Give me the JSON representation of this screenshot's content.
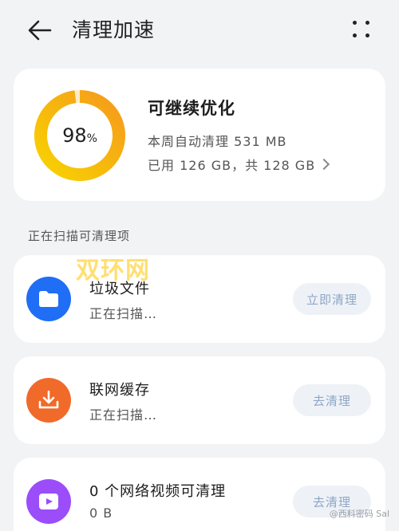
{
  "header": {
    "title": "清理加速",
    "back_icon": "arrow-left-icon",
    "more_icon": "more-dots-icon"
  },
  "storage": {
    "percent_value": "98",
    "percent_unit": "%",
    "percent_fraction": 0.98,
    "title": "可继续优化",
    "weekly_clean": "本周自动清理 531 MB",
    "usage": "已用 126 GB，共 128 GB",
    "ring_colors": [
      "#f8d300",
      "#f59a1c"
    ],
    "ring_track": "#fdecc6"
  },
  "section_title": "正在扫描可清理项",
  "items": [
    {
      "name": "垃圾文件",
      "status": "正在扫描…",
      "button": "立即清理",
      "icon": "folder-icon",
      "color": "#1f6ef5"
    },
    {
      "name": "联网缓存",
      "status": "正在扫描…",
      "button": "去清理",
      "icon": "download-icon",
      "color": "#f06a2a"
    },
    {
      "name": "0 个网络视频可清理",
      "status": "0 B",
      "button": "去清理",
      "icon": "video-icon",
      "color": "#9b4dfa"
    }
  ],
  "watermark": "双环网",
  "credit": "@西料密码 Sal"
}
